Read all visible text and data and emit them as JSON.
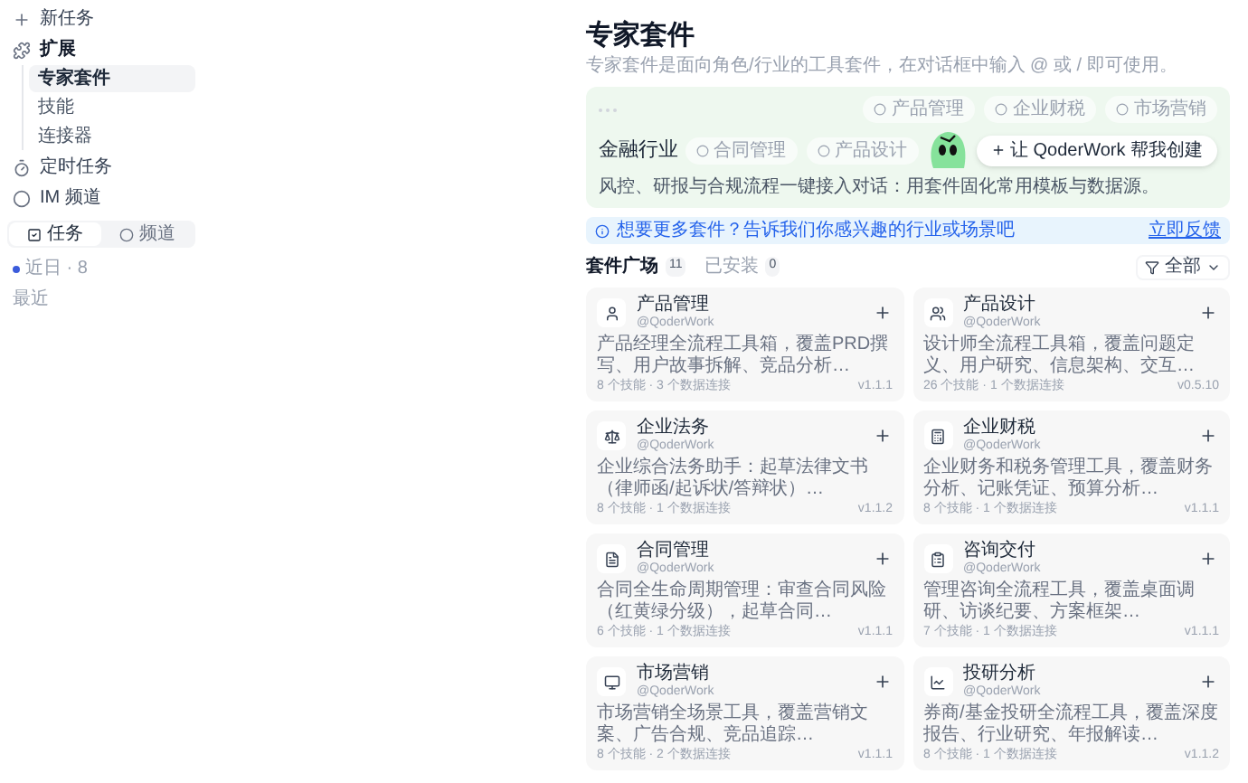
{
  "sidebar": {
    "items": [
      {
        "label": "新任务",
        "kind": "action"
      },
      {
        "label": "扩展",
        "kind": "group",
        "expanded": true,
        "children": [
          {
            "label": "专家套件",
            "selected": true
          },
          {
            "label": "技能",
            "selected": false
          },
          {
            "label": "连接器",
            "selected": false
          }
        ]
      },
      {
        "label": "定时任务",
        "kind": "action"
      },
      {
        "label": "IM 频道",
        "kind": "action"
      }
    ],
    "segments": [
      {
        "label": "任务",
        "selected": true
      },
      {
        "label": "频道",
        "selected": false
      }
    ],
    "recent_label": "近日 · 8",
    "history_label": "最近"
  },
  "page": {
    "title": "专家套件",
    "subtitle": "专家套件是面向角色/行业的工具套件，在对话框中输入 @ 或 / 即可使用。"
  },
  "banner": {
    "chips": [
      "产品管理",
      "企业财税",
      "市场营销",
      "合同管理",
      "产品设计"
    ],
    "title": "金融行业",
    "description": "风控、研报与合规流程一键接入对话：用套件固化常用模板与数据源。",
    "button": "让 QoderWork 帮我创建"
  },
  "notice": {
    "text": "想要更多套件？告诉我们你感兴趣的行业或场景吧",
    "link": "立即反馈"
  },
  "tabs": [
    {
      "label": "套件广场",
      "count": "11",
      "selected": true
    },
    {
      "label": "已安装",
      "count": "0",
      "selected": false
    }
  ],
  "filter": "全部",
  "suites": [
    {
      "name": "产品管理",
      "author": "@QoderWork",
      "description": "产品经理全流程工具箱，覆盖PRD撰写、用户故事拆解、竞品分析…",
      "stats": "8 个技能 · 3 个数据连接",
      "version": "v1.1.1"
    },
    {
      "name": "产品设计",
      "author": "@QoderWork",
      "description": "设计师全流程工具箱，覆盖问题定义、用户研究、信息架构、交互…",
      "stats": "26 个技能 · 1 个数据连接",
      "version": "v0.5.10"
    },
    {
      "name": "企业法务",
      "author": "@QoderWork",
      "description": "企业综合法务助手：起草法律文书（律师函/起诉状/答辩状）…",
      "stats": "8 个技能 · 1 个数据连接",
      "version": "v1.1.2"
    },
    {
      "name": "企业财税",
      "author": "@QoderWork",
      "description": "企业财务和税务管理工具，覆盖财务分析、记账凭证、预算分析…",
      "stats": "8 个技能 · 1 个数据连接",
      "version": "v1.1.1"
    },
    {
      "name": "合同管理",
      "author": "@QoderWork",
      "description": "合同全生命周期管理：审查合同风险（红黄绿分级），起草合同…",
      "stats": "6 个技能 · 1 个数据连接",
      "version": "v1.1.1"
    },
    {
      "name": "咨询交付",
      "author": "@QoderWork",
      "description": "管理咨询全流程工具，覆盖桌面调研、访谈纪要、方案框架…",
      "stats": "7 个技能 · 1 个数据连接",
      "version": "v1.1.1"
    },
    {
      "name": "市场营销",
      "author": "@QoderWork",
      "description": "市场营销全场景工具，覆盖营销文案、广告合规、竞品追踪…",
      "stats": "8 个技能 · 2 个数据连接",
      "version": "v1.1.1"
    },
    {
      "name": "投研分析",
      "author": "@QoderWork",
      "description": "券商/基金投研全流程工具，覆盖深度报告、行业研究、年报解读…",
      "stats": "8 个技能 · 1 个数据连接",
      "version": "v1.1.2"
    }
  ]
}
